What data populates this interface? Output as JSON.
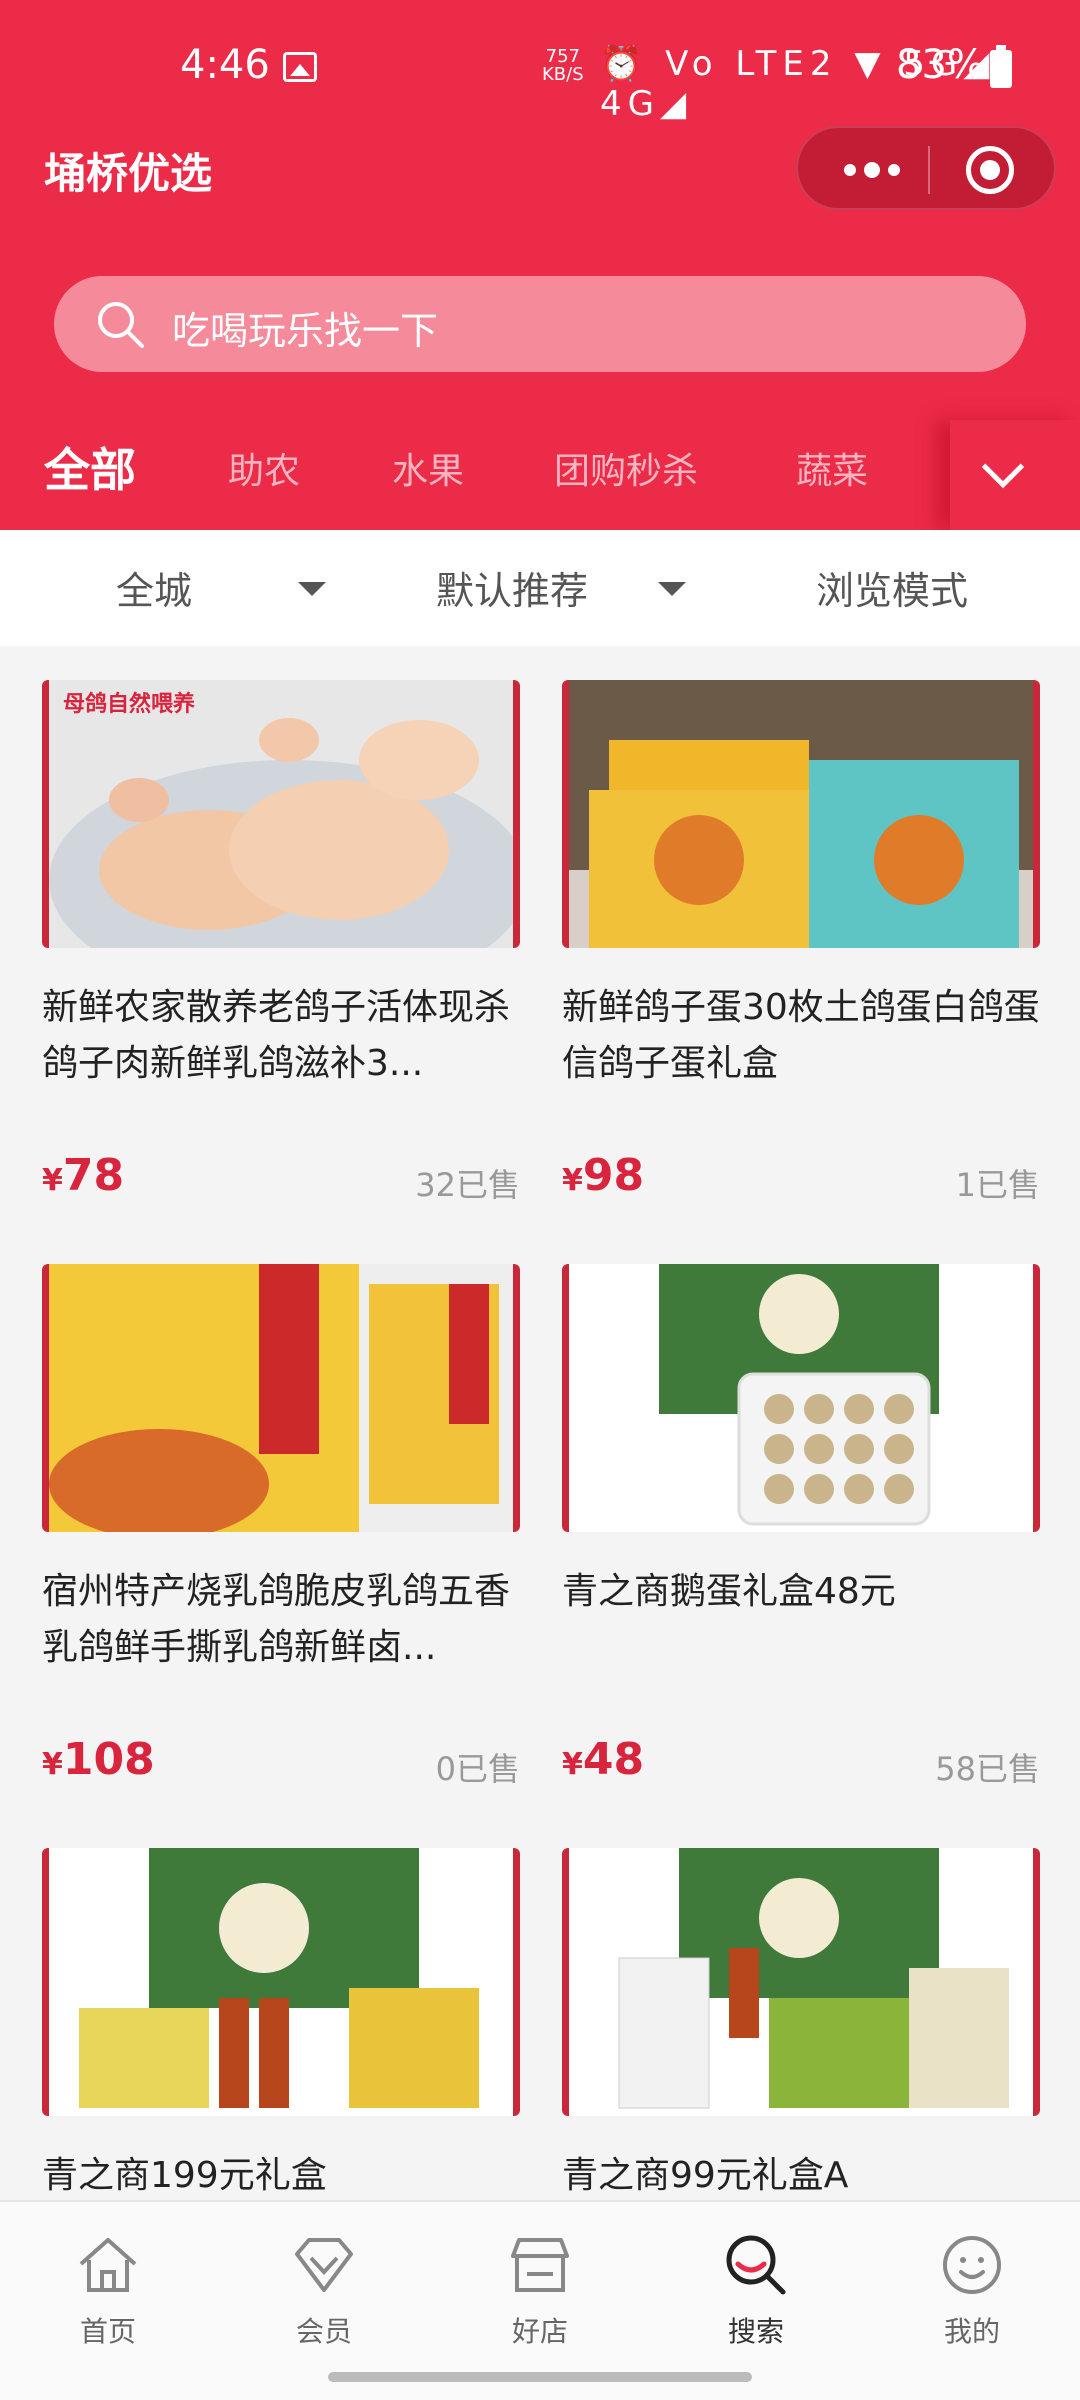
{
  "status_bar": {
    "time": "4:46",
    "speed_value": "757",
    "speed_unit": "KB/S",
    "network_labels": "⏰ Vo LTE2 ▼ 5G◢ 4G◢",
    "battery": "83%"
  },
  "header": {
    "title": "埇桥优选",
    "accent_color": "#ec2b48"
  },
  "search": {
    "placeholder": "吃喝玩乐找一下"
  },
  "tabs": [
    {
      "label": "全部",
      "active": true
    },
    {
      "label": "助农"
    },
    {
      "label": "水果"
    },
    {
      "label": "团购秒杀"
    },
    {
      "label": "蔬菜"
    }
  ],
  "filters": [
    {
      "label": "全城"
    },
    {
      "label": "默认推荐"
    },
    {
      "label": "浏览模式"
    }
  ],
  "products": [
    {
      "title": "新鲜农家散养老鸽子活体现杀鸽子肉新鲜乳鸽滋补3...",
      "currency": "¥",
      "price": "78",
      "sold": "32已售",
      "image_caption": "母鸽自然喂养"
    },
    {
      "title": "新鲜鸽子蛋30枚土鸽蛋白鸽蛋信鸽子蛋礼盒",
      "currency": "¥",
      "price": "98",
      "sold": "1已售"
    },
    {
      "title": "宿州特产烧乳鸽脆皮乳鸽五香乳鸽鲜手撕乳鸽新鲜卤...",
      "currency": "¥",
      "price": "108",
      "sold": "0已售"
    },
    {
      "title": "青之商鹅蛋礼盒48元",
      "currency": "¥",
      "price": "48",
      "sold": "58已售"
    },
    {
      "title": "青之商199元礼盒"
    },
    {
      "title": "青之商99元礼盒A"
    }
  ],
  "bottom_nav": [
    {
      "label": "首页",
      "icon": "home-icon"
    },
    {
      "label": "会员",
      "icon": "diamond-icon"
    },
    {
      "label": "好店",
      "icon": "store-icon"
    },
    {
      "label": "搜索",
      "icon": "search-icon",
      "active": true
    },
    {
      "label": "我的",
      "icon": "smile-icon"
    }
  ]
}
